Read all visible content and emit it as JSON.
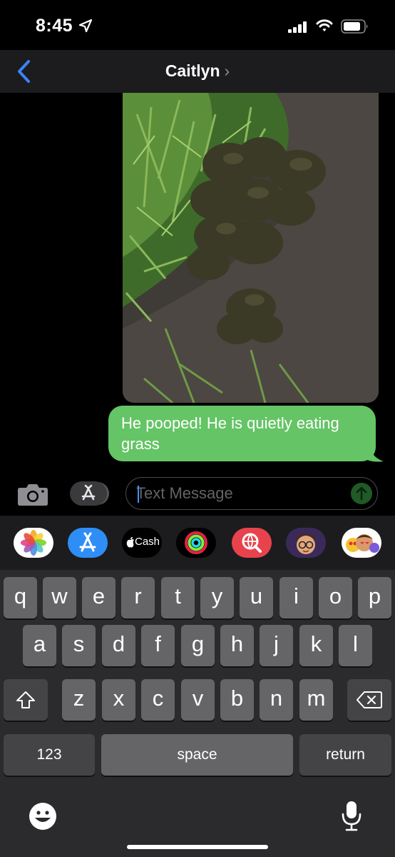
{
  "status_bar": {
    "time": "8:45"
  },
  "nav": {
    "contact_name": "Caitlyn",
    "chevron": "›"
  },
  "message": {
    "text": "He pooped! He is quietly eating grass",
    "bubble_color": "#65c466"
  },
  "input": {
    "placeholder": "Text Message"
  },
  "app_tray": {
    "cash_label": "Cash"
  },
  "keyboard": {
    "row1": [
      "q",
      "w",
      "e",
      "r",
      "t",
      "y",
      "u",
      "i",
      "o",
      "p"
    ],
    "row2": [
      "a",
      "s",
      "d",
      "f",
      "g",
      "h",
      "j",
      "k",
      "l"
    ],
    "row3": [
      "z",
      "x",
      "c",
      "v",
      "b",
      "n",
      "m"
    ],
    "numbers_label": "123",
    "space_label": "space",
    "return_label": "return"
  }
}
